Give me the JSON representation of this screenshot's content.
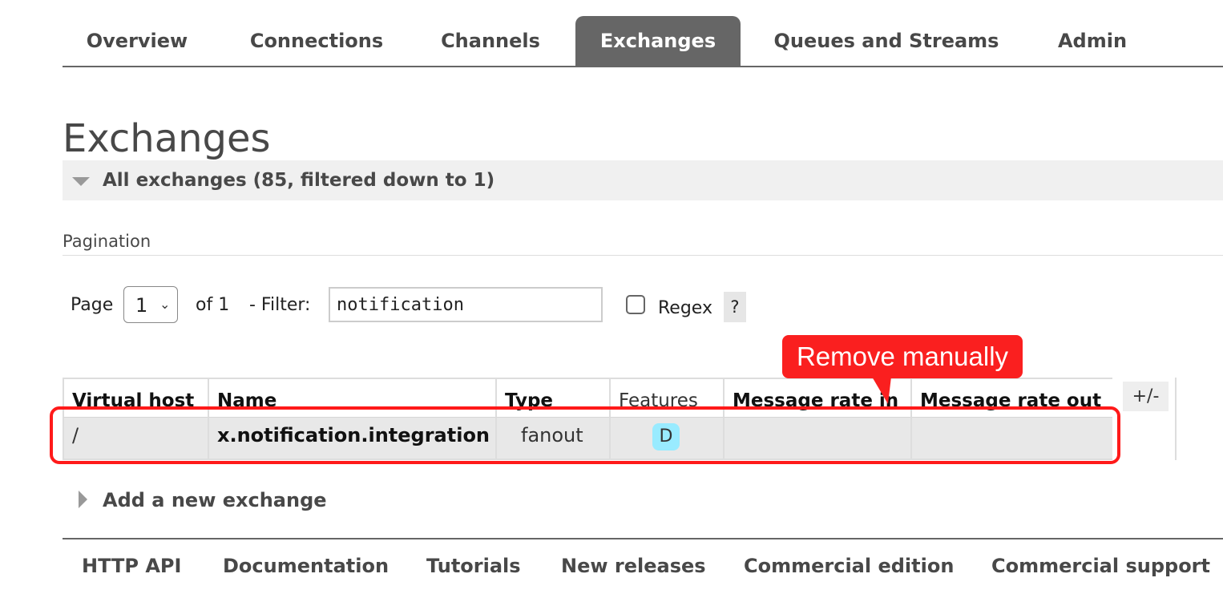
{
  "nav": {
    "tabs": [
      {
        "label": "Overview"
      },
      {
        "label": "Connections"
      },
      {
        "label": "Channels"
      },
      {
        "label": "Exchanges",
        "active": true
      },
      {
        "label": "Queues and Streams"
      },
      {
        "label": "Admin"
      }
    ]
  },
  "page": {
    "title": "Exchanges",
    "section_label": "All exchanges (85, filtered down to 1)"
  },
  "pagination": {
    "heading": "Pagination",
    "page_label": "Page",
    "page_value": "1",
    "of_label": "of 1",
    "filter_label": "- Filter:",
    "filter_value": "notification",
    "regex_label": "Regex",
    "regex_checked": false,
    "help_label": "?"
  },
  "table": {
    "columns": [
      "Virtual host",
      "Name",
      "Type",
      "Features",
      "Message rate in",
      "Message rate out"
    ],
    "rows": [
      {
        "virtual_host": "/",
        "name": "x.notification.integration",
        "type": "fanout",
        "features": "D",
        "rate_in": "",
        "rate_out": ""
      }
    ],
    "column_toggle": "+/-"
  },
  "annotation": {
    "callout_text": "Remove manually",
    "color": "#ff1a1a"
  },
  "add_exchange": {
    "label": "Add a new exchange"
  },
  "footer": {
    "links": [
      "HTTP API",
      "Documentation",
      "Tutorials",
      "New releases",
      "Commercial edition",
      "Commercial support"
    ]
  },
  "colors": {
    "active_tab": "#666666",
    "feature_badge": "#99ebff",
    "annotation_red": "#fa1f1f"
  }
}
